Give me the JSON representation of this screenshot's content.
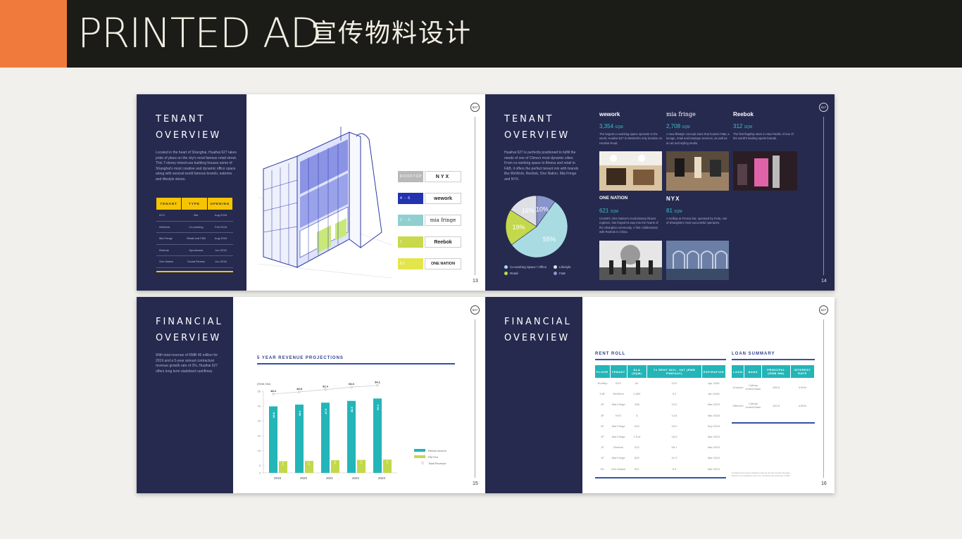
{
  "header": {
    "title_en": "PRINTED AD",
    "title_cn": "宣传物料设计"
  },
  "badge_text": "627",
  "page13": {
    "title_line1": "TENANT",
    "title_line2": "OVERVIEW",
    "body": "Located in the heart of Shanghai, Huaihai 627 takes pride of place on the city's most famous retail street. This 7-storey mixed-use building houses some of Shanghai's most creative and dynamic office space along with several world famous brands, eateries and lifestyle stores.",
    "table_headers": [
      "TENANT",
      "TYPE",
      "OPENING"
    ],
    "table_rows": [
      [
        "NYX",
        "Bar",
        "Aug 2018"
      ],
      [
        "WeWork",
        "Co-working",
        "Feb 2018"
      ],
      [
        "Mia Fringe",
        "Retail and F&B",
        "Aug 2018"
      ],
      [
        "Reebok",
        "Sportswear",
        "Jun 2018"
      ],
      [
        "One Nation",
        "Social Fitness",
        "Jun 2018"
      ]
    ],
    "floors": [
      {
        "label": "ROOFTOP",
        "brand": "NYX",
        "color": "#b9b9b9"
      },
      {
        "label": "4 - 6",
        "brand": "wework",
        "color": "#2333b0"
      },
      {
        "label": "1 - 3",
        "brand": "mia fringe",
        "color": "#8fcfd0"
      },
      {
        "label": "1",
        "brand": "Reebok",
        "color": "#c9d949"
      },
      {
        "label": "B1",
        "brand": "ONE NATION",
        "color": "#e3e64a"
      }
    ],
    "page_no": "13"
  },
  "page14": {
    "title_line1": "TENANT",
    "title_line2": "OVERVIEW",
    "body": "Huaihai 627 is perfectly positioned to fulfill the needs of one of China's most dynamic cities. From co-working space to fitness and retail to F&B, it offers the perfect tenant mix with brands like WeWork, Reebok, One Nation, Mia Fringe and NYX.",
    "brands": [
      {
        "name": "wework",
        "num": "3,354",
        "unit": "SQM",
        "desc": "The largest co-working space operator in the world, Huaihai 627 is WeWork's only location on Huaihai Road."
      },
      {
        "name": "mia fringe",
        "num": "2,708",
        "unit": "SQM",
        "desc": "A new lifestyle concept store that houses F&B, a lounge, retail and boutique services, as well as an art and styling studio."
      },
      {
        "name": "Reebok",
        "num": "312",
        "unit": "SQM",
        "desc": "The first flagship store in Asia Pacific of one of the world's leading sports brands."
      },
      {
        "name": "ONE NATION",
        "num": "621",
        "unit": "SQM",
        "desc": "CrossFit, One Nation's revolutionary fitness regimen, has forged its way into the hearts of the Shanghai community. A first collaboration with Reebok in China."
      },
      {
        "name": "NYX",
        "num": "81",
        "unit": "SQM",
        "desc": "A rooftop at Fresca bar, operated by Fiola, one of Shanghai's most successful operators."
      }
    ],
    "pie": {
      "slices": [
        {
          "label": "Co-working Space / Office",
          "value": 55,
          "text": "55%",
          "color": "#a9dbe3"
        },
        {
          "label": "Retail",
          "value": 19,
          "text": "19%",
          "color": "#c3d84a"
        },
        {
          "label": "Lifestyle",
          "value": 16,
          "text": "16%",
          "color": "#dfe0e6"
        },
        {
          "label": "F&B",
          "value": 10,
          "text": "10%",
          "color": "#8895cc"
        }
      ]
    },
    "page_no": "14"
  },
  "page15": {
    "title_line1": "FINANCIAL",
    "title_line2": "OVERVIEW",
    "body": "With total revenue of RMB 46 million for 2019 and a 5-year annual contractual revenue growth rate of 3%, Huaihai 627 offers long term stabilized cashflows.",
    "chart_title": "5 YEAR REVENUE PROJECTIONS",
    "page_no": "15"
  },
  "chart_data": {
    "type": "bar",
    "title": "5 YEAR REVENUE PROJECTIONS",
    "ylabel": "(RMB MM)",
    "categories": [
      "2019",
      "2020",
      "2021",
      "2022",
      "2023"
    ],
    "series": [
      {
        "name": "Rental Income",
        "values": [
          44.8,
          46.0,
          47.3,
          48.5,
          50.1
        ],
        "color": "#23b5b8"
      },
      {
        "name": "PM Fee",
        "values": [
          3.6,
          3.7,
          3.9,
          4.0,
          4.1
        ],
        "color": "#c3d84a"
      },
      {
        "name": "Total Revenue",
        "values": [
          48.4,
          49.8,
          51.4,
          53.0,
          54.2
        ],
        "color": "#bbbbbb"
      }
    ],
    "ylim": [
      0,
      55
    ],
    "yticks": [
      0,
      5,
      15,
      25,
      35,
      45,
      55
    ],
    "yticks_labels": [
      "0",
      "5",
      "15",
      "25",
      "35",
      "45",
      "55"
    ],
    "bar_labels": [
      "44.8",
      "46.0",
      "47.3",
      "48.5",
      "50.1"
    ],
    "fee_labels": [
      "3.6",
      "3.7",
      "3.9",
      "4.0",
      "4.1"
    ],
    "total_labels": [
      "48.4",
      "49.8",
      "51.4",
      "53.0",
      "54.2"
    ],
    "legend": [
      "Rental Income",
      "PM Fee",
      "Total Revenue"
    ]
  },
  "page16": {
    "title_line1": "FINANCIAL",
    "title_line2": "OVERVIEW",
    "rent_roll_title": "RENT ROLL",
    "rent_headers": [
      "FLOOR",
      "TENANT",
      "NLA (SQM)",
      "Y1 RENT INCL. VAT (RMB PSM/DAY)",
      "EXPIRATION"
    ],
    "rent_rows": [
      [
        "Rooftop",
        "NYX",
        "81",
        "10.0",
        "Apr 2026"
      ],
      [
        "4-6F",
        "WeWork",
        "3,354",
        "9.2",
        "Jan 2028"
      ],
      [
        "3F",
        "Mia Fringe",
        "338",
        "13.0",
        "Mar 2023"
      ],
      [
        "3F",
        "NYX",
        "8",
        "14.8",
        "Mar 2026"
      ],
      [
        "3F",
        "Mia Fringe",
        "510",
        "15.0",
        "Sep 2023"
      ],
      [
        "2F",
        "Mia Fringe",
        "1,014",
        "18.0",
        "Mar 2023"
      ],
      [
        "1F",
        "Reebok",
        "312",
        "59.1",
        "Mar 2023"
      ],
      [
        "1F",
        "Mia Fringe",
        "820",
        "41.0",
        "Mar 2023"
      ],
      [
        "B1",
        "One Nation",
        "621",
        "5.3",
        "Mar 2023"
      ]
    ],
    "loan_title": "LOAN SUMMARY",
    "loan_headers": [
      "LOAN",
      "BANK",
      "PRINCIPAL (RMB MM)",
      "INTEREST RATE"
    ],
    "loan_rows": [
      [
        "Onshore",
        "Cathay United Bank",
        "296.5",
        "4.90%"
      ],
      [
        "Offshore",
        "Cathay United Bank",
        "220.6",
        "4.89%"
      ]
    ],
    "footnote": "(1) Rents are gross including property tax and service charges. Fitout is not included in the rent. (2) Rents are inclusive of VAT.",
    "page_no": "16"
  }
}
